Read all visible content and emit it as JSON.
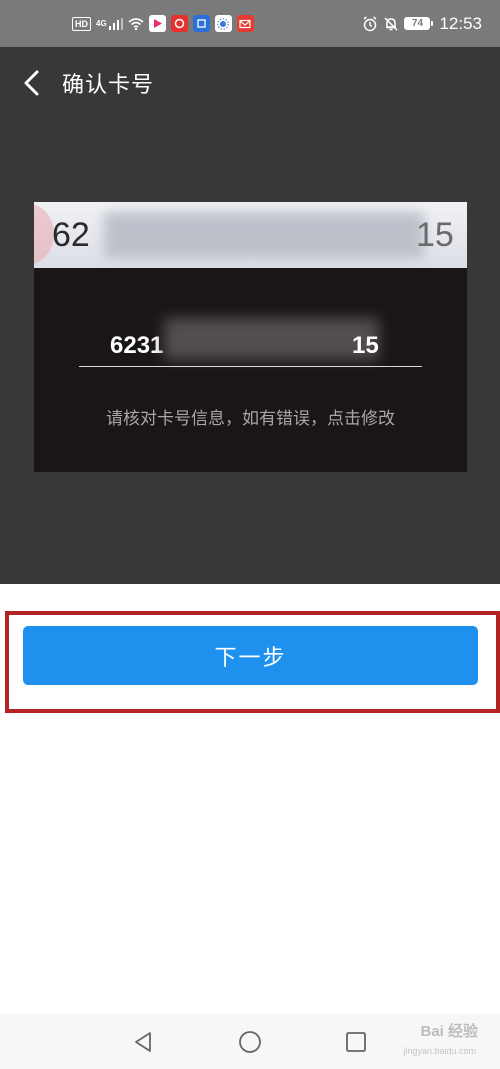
{
  "status_bar": {
    "hd_tag": "HD",
    "network": "4G",
    "battery": "74",
    "time": "12:53",
    "icons": [
      "signal-icon",
      "wifi-icon",
      "app-video-icon",
      "app-music-icon",
      "app-news-icon",
      "app-sun-icon",
      "app-mail-icon",
      "alarm-icon",
      "mute-bell-icon"
    ]
  },
  "header": {
    "title": "确认卡号"
  },
  "card_strip": {
    "number_prefix": "62",
    "number_suffix": "15"
  },
  "confirm_panel": {
    "number_prefix": "6231",
    "number_suffix": "15",
    "hint": "请核对卡号信息，如有错误，点击修改"
  },
  "next_button": {
    "label": "下一步"
  },
  "colors": {
    "primary": "#1e91ef",
    "highlight": "#b42323",
    "camera_bg": "#383838",
    "panel_bg": "#1a1517"
  },
  "watermark": {
    "brand": "Bai 经验",
    "url": "jingyan.baidu.com"
  }
}
